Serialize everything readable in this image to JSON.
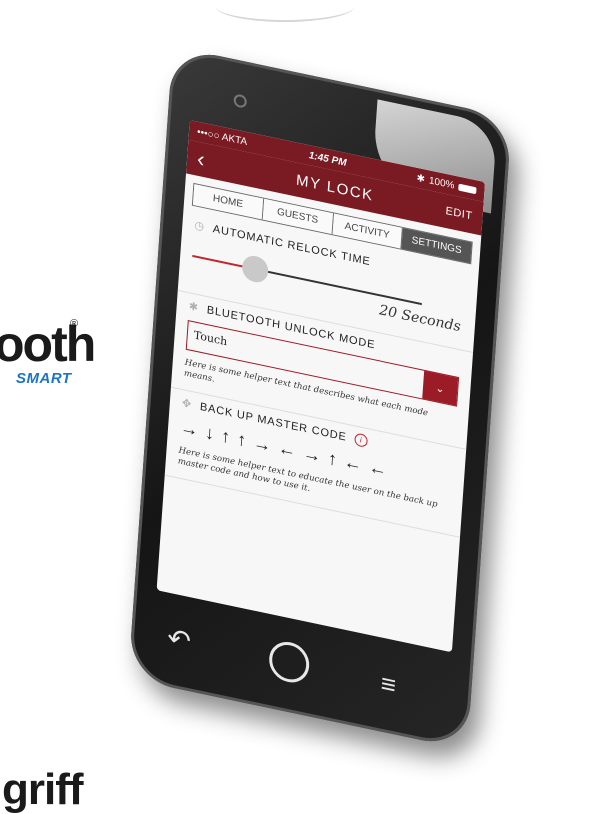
{
  "background": {
    "brand_word": "ooth",
    "brand_reg": "®",
    "brand_sub": "SMART",
    "brand_bottom": "griff"
  },
  "status_bar": {
    "carrier": "•••○○ AKTA",
    "time": "1:45 PM",
    "battery": "100%"
  },
  "header": {
    "back_icon": "chevron-left-icon",
    "title": "MY LOCK",
    "edit_label": "EDIT"
  },
  "tabs": [
    {
      "label": "HOME",
      "active": false
    },
    {
      "label": "GUESTS",
      "active": false
    },
    {
      "label": "ACTIVITY",
      "active": false
    },
    {
      "label": "SETTINGS",
      "active": true
    }
  ],
  "relock": {
    "title": "AUTOMATIC RELOCK TIME",
    "value": "20 Seconds"
  },
  "bluetooth": {
    "title": "BLUETOOTH UNLOCK MODE",
    "selected": "Touch",
    "helper": "Here is some helper text that describes what each mode means."
  },
  "backup": {
    "title": "BACK UP MASTER CODE",
    "code": [
      "→",
      "↓",
      "↑",
      "↑",
      "→",
      "←",
      "→",
      "↑",
      "←",
      "←"
    ],
    "helper": "Here is some helper text to educate the user on the back up master code and how to use it."
  },
  "colors": {
    "header": "#7a1a22",
    "accent": "#9b1c27",
    "slider": "#c0272d"
  }
}
